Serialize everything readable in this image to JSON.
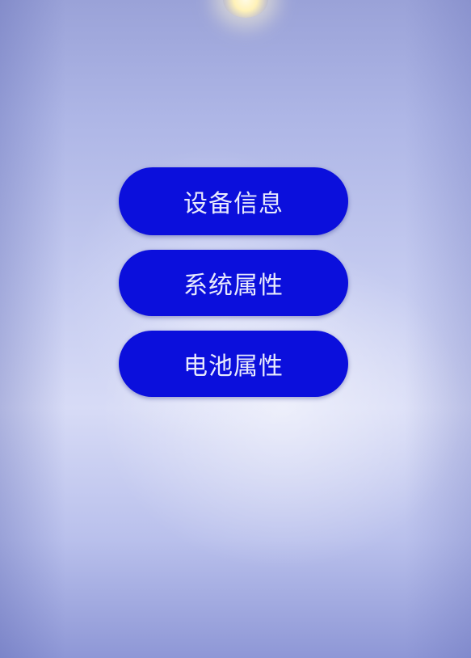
{
  "menu": {
    "items": [
      {
        "label": "设备信息"
      },
      {
        "label": "系统属性"
      },
      {
        "label": "电池属性"
      }
    ]
  },
  "colors": {
    "button_background": "#0b0fdc",
    "button_text": "#e8eafd",
    "screen_background": "#c7cdf1"
  }
}
